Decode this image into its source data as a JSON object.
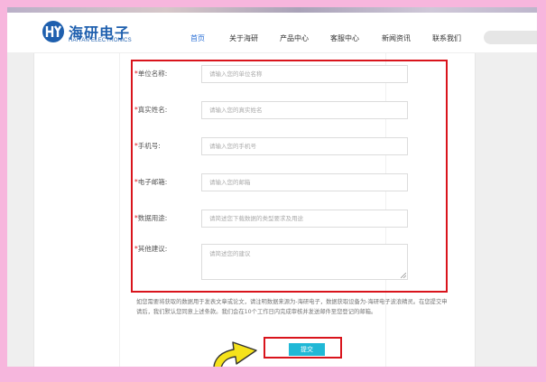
{
  "brand": {
    "name_cn": "海研电子",
    "name_en": "HAIYAN ELECTRONICS",
    "color": "#1e5fae"
  },
  "nav": {
    "items": [
      {
        "label": "首页",
        "active": true
      },
      {
        "label": "关于海研",
        "active": false
      },
      {
        "label": "产品中心",
        "active": false
      },
      {
        "label": "客服中心",
        "active": false
      },
      {
        "label": "新闻资讯",
        "active": false
      },
      {
        "label": "联系我们",
        "active": false
      }
    ]
  },
  "form": {
    "fields": [
      {
        "label": "*单位名称:",
        "placeholder": "请输入您的单位名称"
      },
      {
        "label": "*真实姓名:",
        "placeholder": "请输入您的真实姓名"
      },
      {
        "label": "*手机号:",
        "placeholder": "请输入您的手机号"
      },
      {
        "label": "*电子邮箱:",
        "placeholder": "请输入您的邮箱"
      },
      {
        "label": "*数据用途:",
        "placeholder": "请简述您下载数据的类型要求及用途"
      },
      {
        "label": "*其他建议:",
        "placeholder": "请简述您的建议"
      }
    ],
    "notice": "如您需要将获取的数据用于发表文章或论文，请注明数据来源为-海研电子，数据获取设备为-海研电子波浪精灵。在您提交申请后，我们默认您同意上述条款。我们会在10个工作日内完成审核并发送邮件至您登记的邮箱。",
    "submit_label": "提交"
  },
  "colors": {
    "accent_red": "#d9141c",
    "submit_bg": "#20b8d6",
    "nav_active": "#2a6fd6",
    "page_bg": "#f7b6dd",
    "arrow_fill": "#f5e21b"
  }
}
